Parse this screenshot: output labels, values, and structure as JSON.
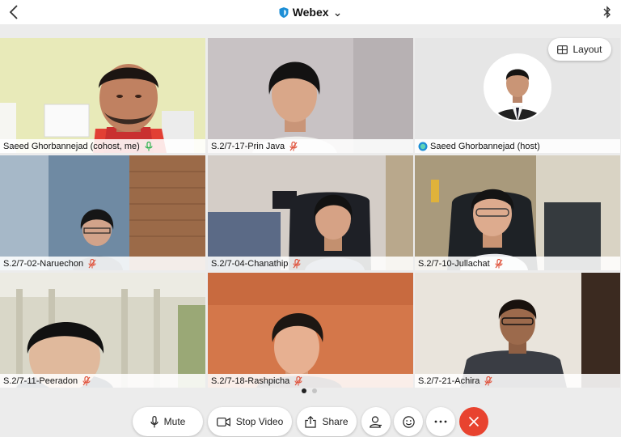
{
  "header": {
    "title": "Webex",
    "caret": "⌄"
  },
  "layout_button": {
    "label": "Layout"
  },
  "participants": [
    {
      "name": "Saeed Ghorbannejad (cohost, me)",
      "mic_on": true,
      "active": true
    },
    {
      "name": "S.2/7-17-Prin Java",
      "mic_on": false
    },
    {
      "name": "Saeed Ghorbannejad (host)",
      "mic_on": true,
      "avatar_only": true
    },
    {
      "name": "S.2/7-02-Naruechon",
      "mic_on": false
    },
    {
      "name": "S.2/7-04-Chanathip",
      "mic_on": false
    },
    {
      "name": "S.2/7-10-Jullachat",
      "mic_on": false
    },
    {
      "name": "S.2/7-11-Peeradon",
      "mic_on": false
    },
    {
      "name": "S.2/7-18-Rashpicha",
      "mic_on": false
    },
    {
      "name": "S.2/7-21-Achira",
      "mic_on": false
    }
  ],
  "pager": {
    "current": 1,
    "total": 2
  },
  "controls": {
    "mute_label": "Mute",
    "stop_video_label": "Stop Video",
    "share_label": "Share"
  },
  "colors": {
    "active_border": "#3ba6a0",
    "end_call": "#e8432f",
    "muted_mic": "#e0553f",
    "live_mic": "#2bb24c",
    "webex_shield": "#1c8ed6"
  }
}
